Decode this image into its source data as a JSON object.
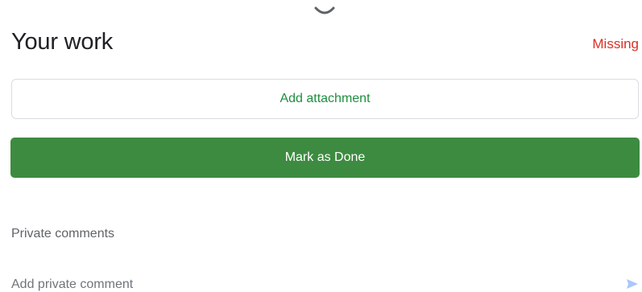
{
  "header": {
    "title": "Your work",
    "status": "Missing"
  },
  "actions": {
    "attach_label": "Add attachment",
    "done_label": "Mark as Done"
  },
  "comments": {
    "section_label": "Private comments",
    "placeholder": "Add private comment"
  },
  "colors": {
    "accent_green": "#3d8b40",
    "attach_text_green": "#1e8e3e",
    "missing_red": "#d93025",
    "send_icon_blue": "#a8c7fa"
  },
  "icons": {
    "drag_handle": "drag-handle-icon",
    "send": "send-icon"
  }
}
